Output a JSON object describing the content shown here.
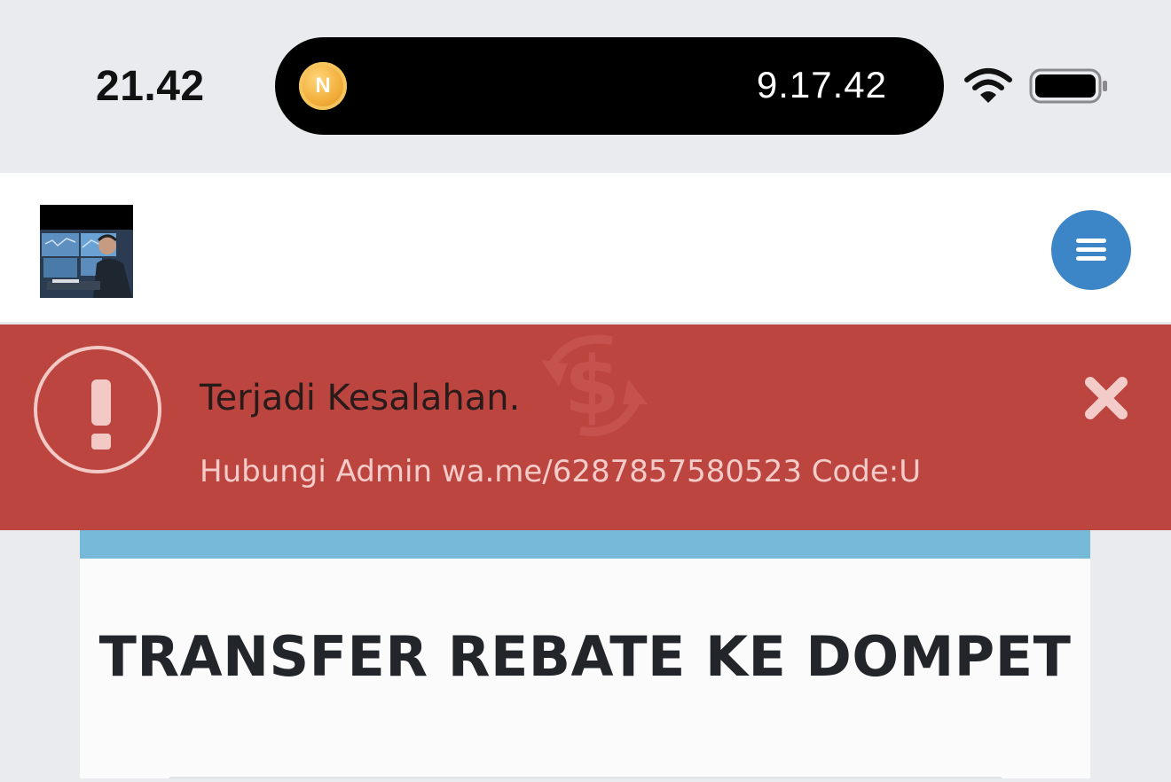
{
  "status_bar": {
    "clock": "21.42",
    "island_badge": "N",
    "island_time": "9.17.42",
    "icons": [
      "wifi-icon",
      "battery-icon"
    ]
  },
  "header": {
    "logo_icon": "trader-photo-logo",
    "menu_icon": "hamburger-menu-icon",
    "menu_color": "#3c86c8"
  },
  "alert": {
    "title": "Terjadi Kesalahan.",
    "message": "Hubungi Admin wa.me/6287857580523 Code:U",
    "icon": "exclamation-circle-icon",
    "close_icon": "close-icon",
    "color": "#bc4540"
  },
  "page": {
    "title": "TRANSFER REBATE KE DOMPET",
    "stripe_color": "#77b9d8"
  }
}
